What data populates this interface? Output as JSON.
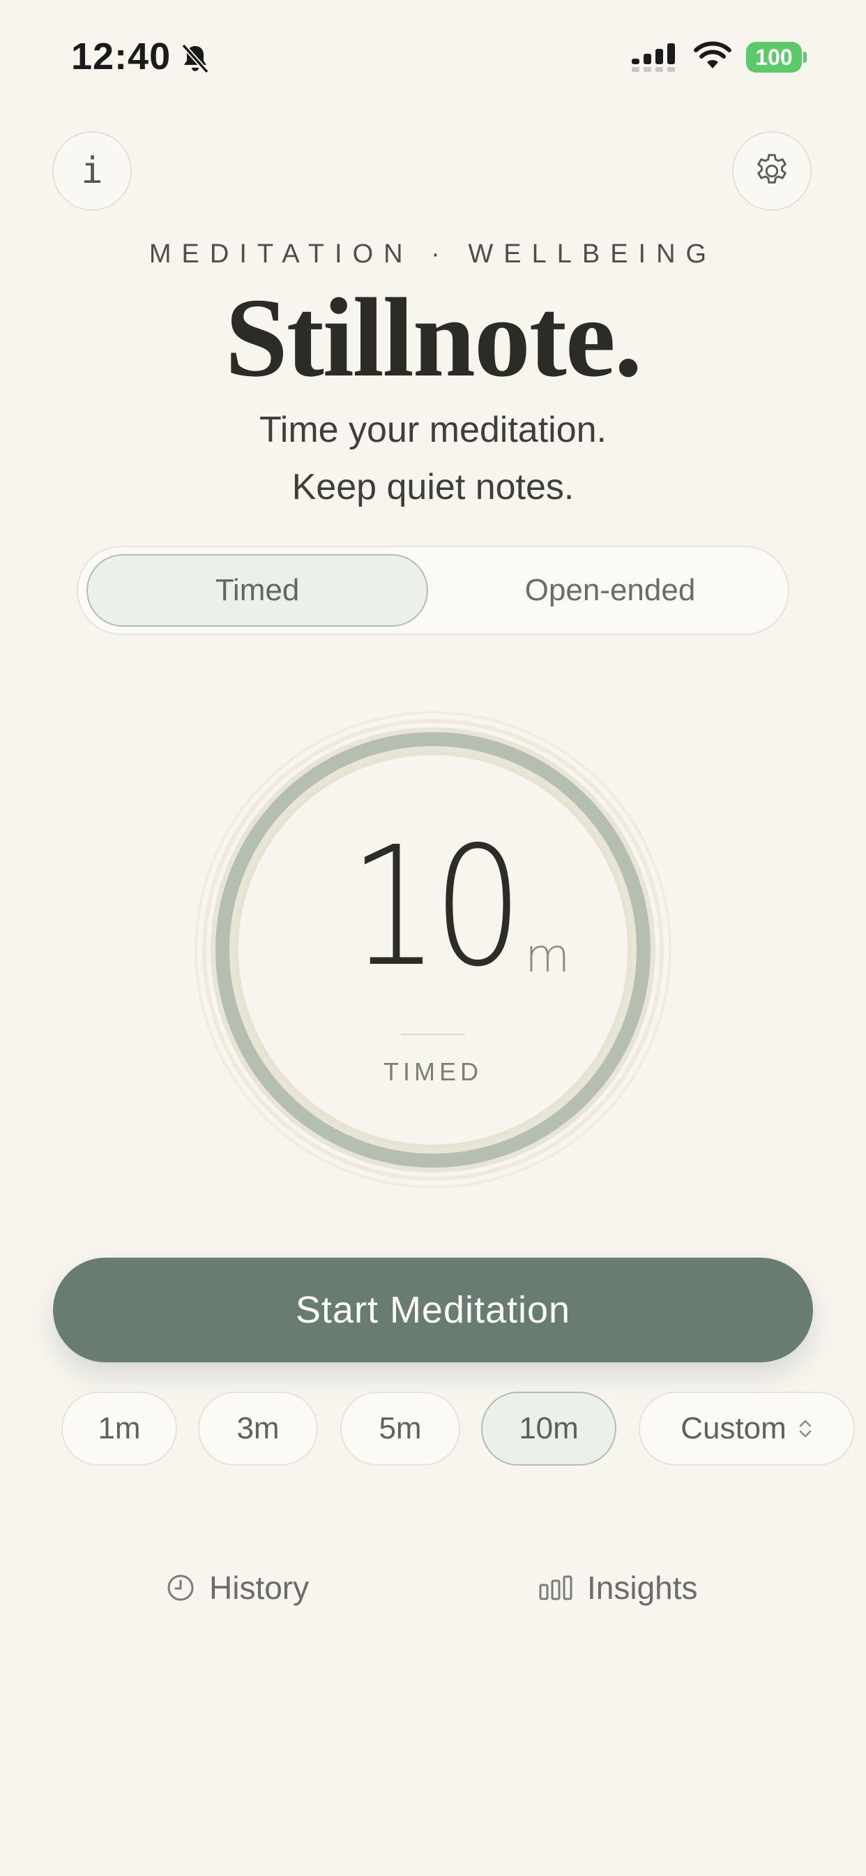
{
  "status_bar": {
    "time": "12:40",
    "battery": "100",
    "battery_color": "#5cc96a"
  },
  "header": {
    "info_icon": "info-icon",
    "settings_icon": "gear-icon",
    "eyebrow": "MEDITATION · WELLBEING",
    "title": "Stillnote.",
    "tagline_line1": "Time your meditation.",
    "tagline_line2": "Keep quiet notes."
  },
  "mode_toggle": {
    "options": [
      "Timed",
      "Open-ended"
    ],
    "selected": "Timed"
  },
  "dial": {
    "value": "10",
    "unit": "m",
    "mode_label": "TIMED",
    "ring_color": "#b5bfb1",
    "track_color": "#e8e4d6"
  },
  "start_button": {
    "label": "Start Meditation",
    "color": "#687c72"
  },
  "presets": {
    "items": [
      "1m",
      "3m",
      "5m",
      "10m",
      "Custom"
    ],
    "selected": "10m",
    "custom_icon": "chevron-up-down-icon"
  },
  "footer": {
    "history_label": "History",
    "history_icon": "clock-icon",
    "insights_label": "Insights",
    "insights_icon": "bar-chart-icon"
  },
  "colors": {
    "background": "#f7f5ee",
    "accent": "#687c72",
    "selected_fill": "#ecf0eb"
  }
}
